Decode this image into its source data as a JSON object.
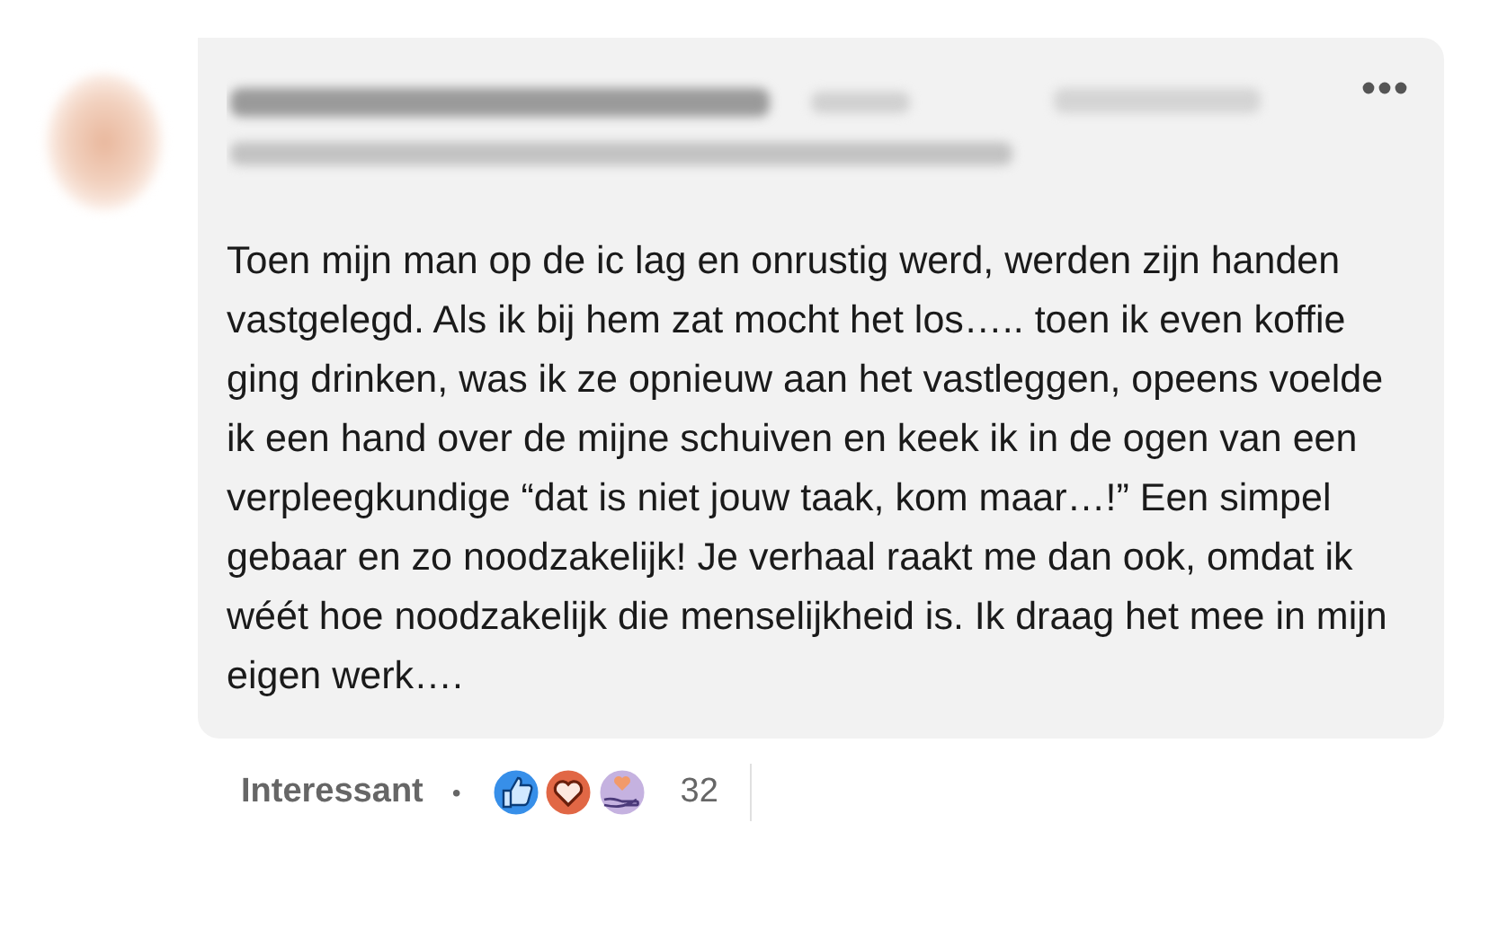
{
  "comment": {
    "text": "Toen mijn man op de ic lag en onrustig werd, werden zijn handen vastgelegd. Als ik bij hem zat mocht het los….. toen ik even koffie ging drinken, was ik ze opnieuw aan het vastleggen, opeens voelde ik een hand over de mijne schuiven en keek ik in de ogen van een verpleegkundige “dat is niet jouw taak, kom maar…!” Een simpel gebaar en zo noodzakelijk! Je verhaal raakt me dan ook, omdat ik wéét hoe noodzakelijk die menselijkheid is. Ik draag het mee in mijn eigen werk…."
  },
  "footer": {
    "reaction_label": "Interessant",
    "separator": "•",
    "reaction_count": "32"
  }
}
